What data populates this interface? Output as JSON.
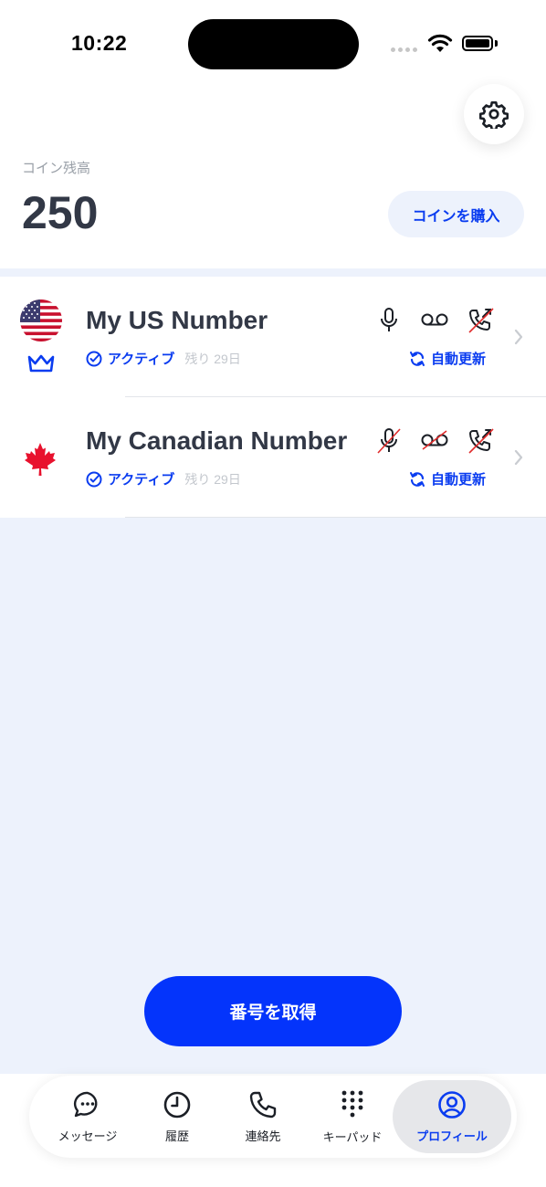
{
  "status_bar": {
    "time": "10:22"
  },
  "header": {
    "settings_icon": "gear-icon",
    "coin_label": "コイン残高",
    "coin_value": "250",
    "buy_label": "コインを購入"
  },
  "numbers": [
    {
      "flag": "us-flag",
      "premium_icon": "crown-icon",
      "name": "My US Number",
      "status": "アクティブ",
      "remaining": "残り 29日",
      "renew": "自動更新",
      "features": {
        "voice": true,
        "voicemail": true,
        "forwarding": false
      }
    },
    {
      "flag": "canada-flag",
      "name": "My Canadian Number",
      "status": "アクティブ",
      "remaining": "残り 29日",
      "renew": "自動更新",
      "features": {
        "voice": false,
        "voicemail": false,
        "forwarding": false
      }
    }
  ],
  "get_number_label": "番号を取得",
  "tabs": [
    {
      "label": "メッセージ",
      "icon": "chat-bubble-icon",
      "active": false
    },
    {
      "label": "履歴",
      "icon": "clock-icon",
      "active": false
    },
    {
      "label": "連絡先",
      "icon": "phone-icon",
      "active": false
    },
    {
      "label": "キーパッド",
      "icon": "keypad-icon",
      "active": false
    },
    {
      "label": "プロフィール",
      "icon": "profile-icon",
      "active": true
    }
  ],
  "colors": {
    "accent": "#0434fb",
    "background": "#edf2fc",
    "disabled_slash": "#e02b2b"
  }
}
